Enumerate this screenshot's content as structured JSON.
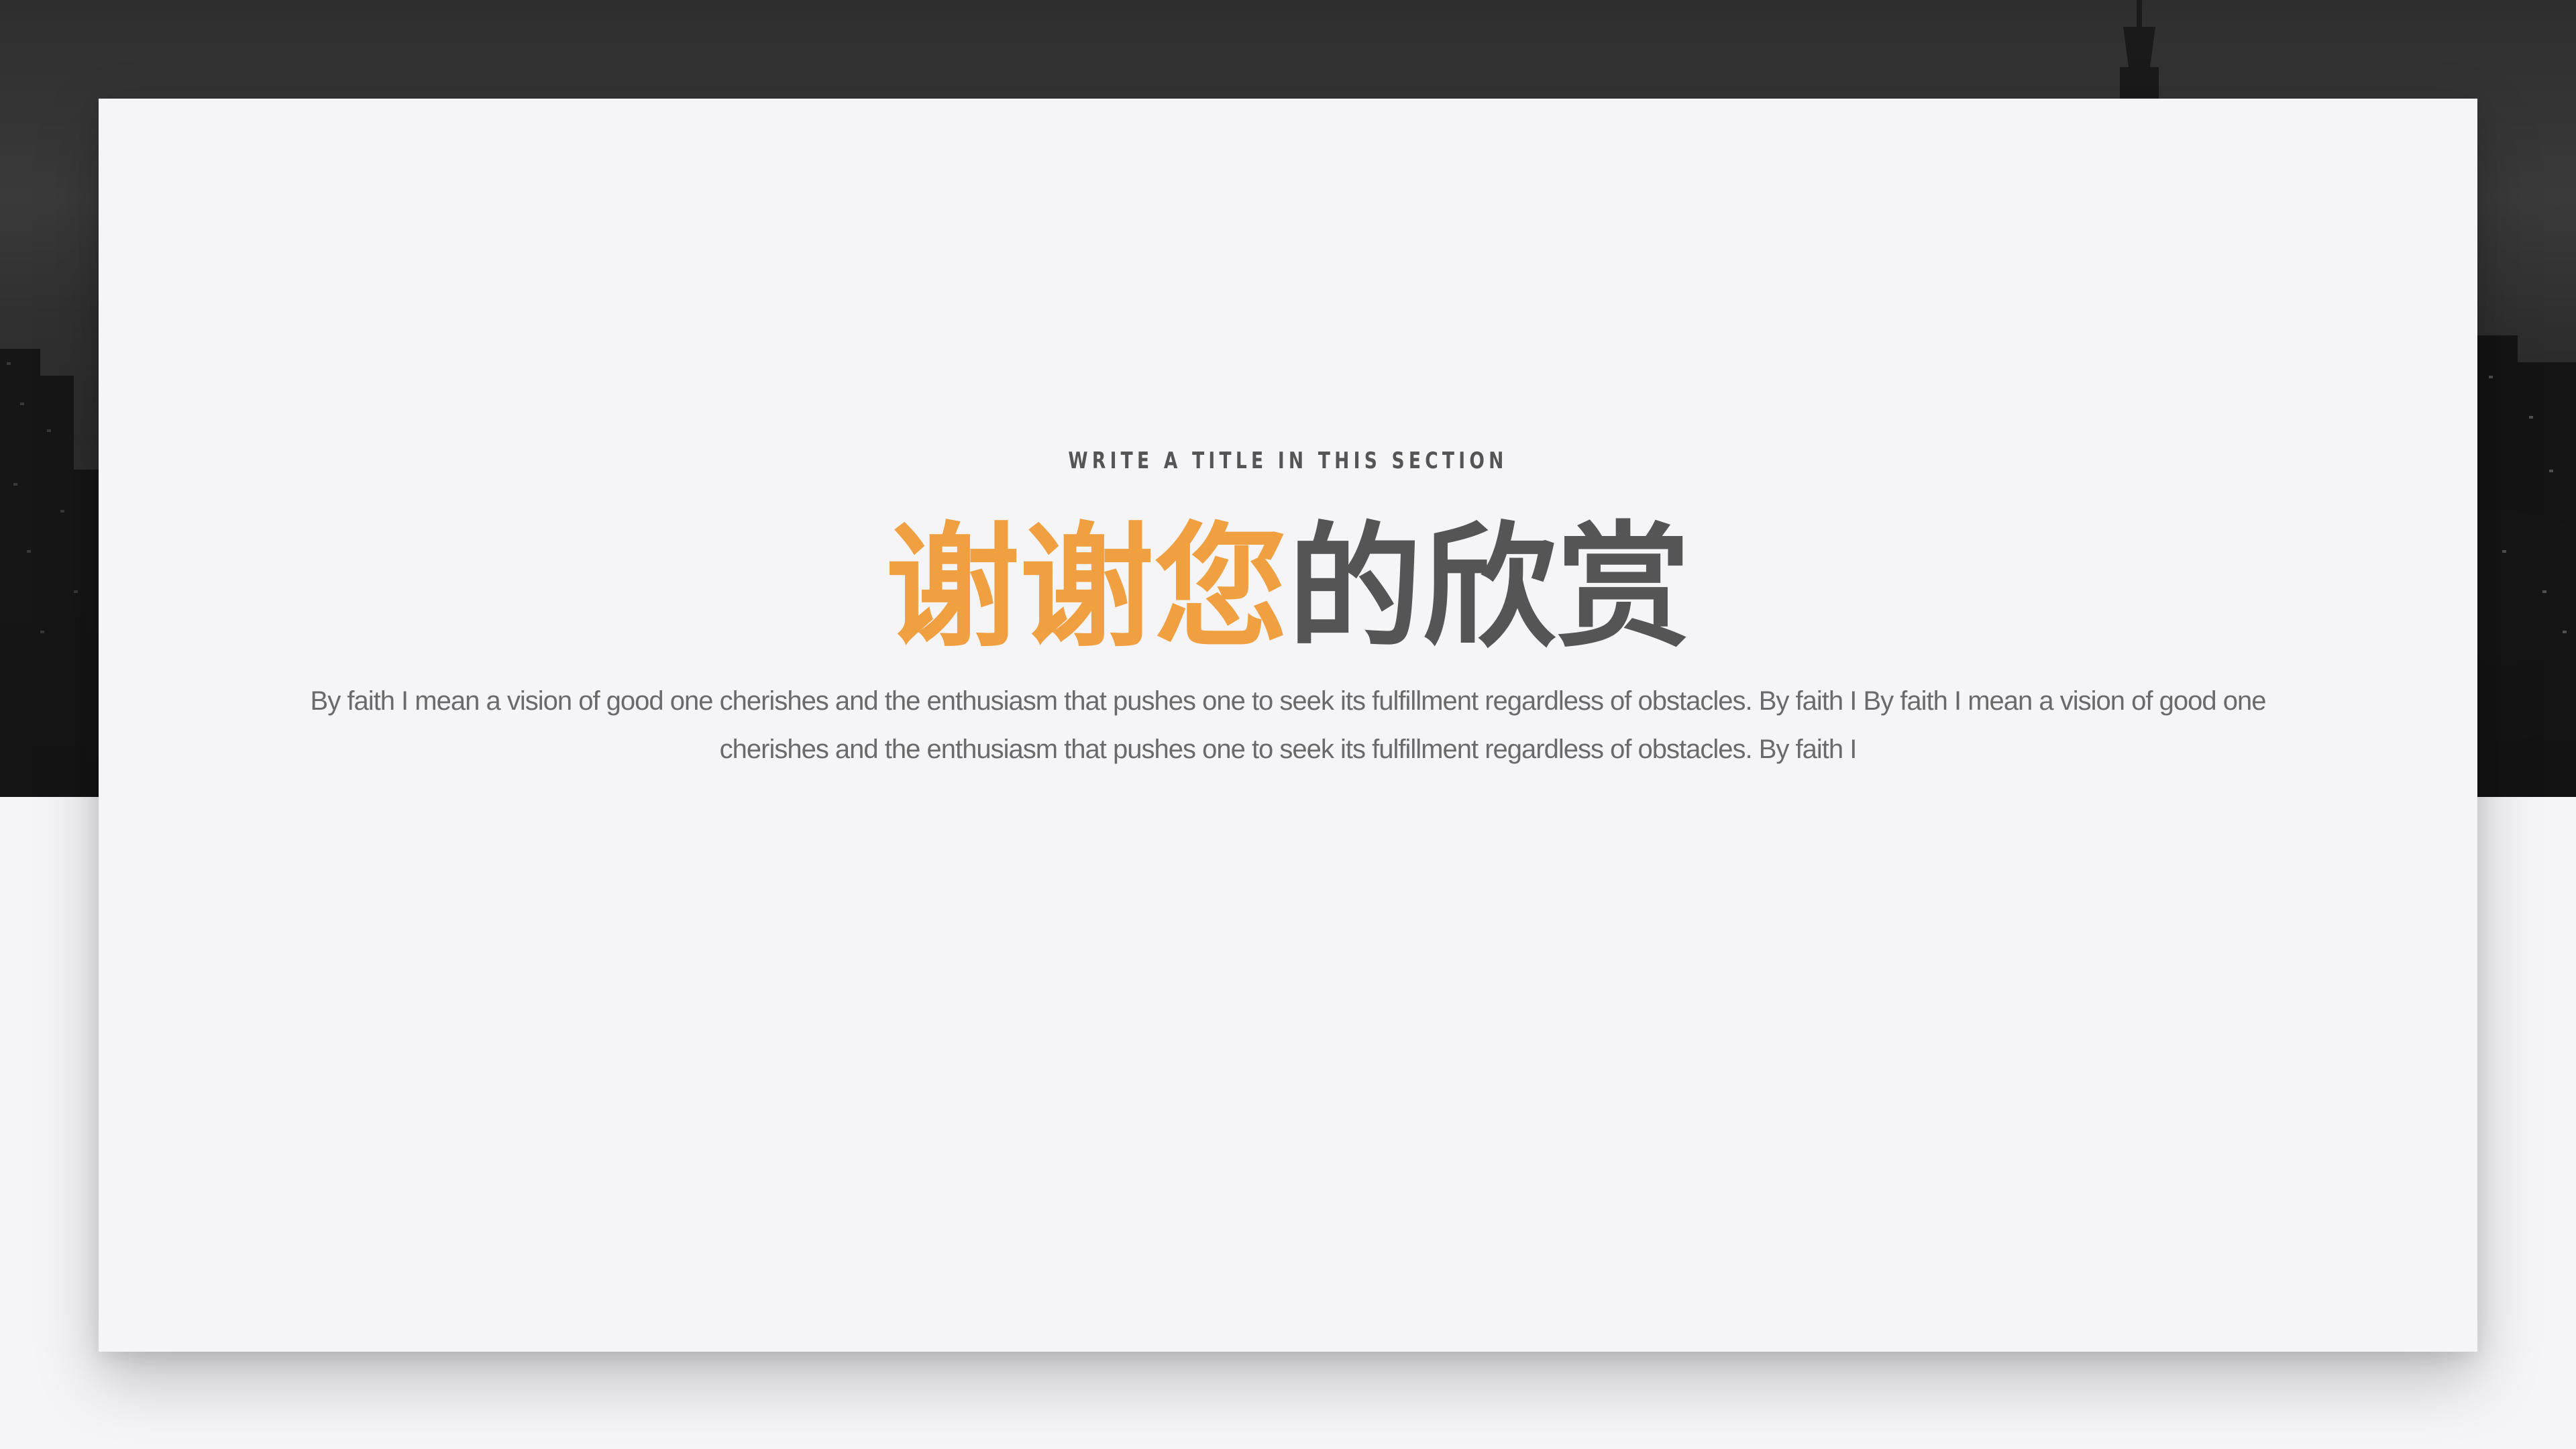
{
  "slide": {
    "eyebrow": "WRITE A TITLE IN THIS SECTION",
    "headline_accent": "谢谢您",
    "headline_rest": "的欣赏",
    "body": "By faith I mean a vision of good one cherishes and the enthusiasm that pushes one to seek its fulfillment regardless of obstacles. By faith I By faith I mean a vision of good one cherishes and the enthusiasm that pushes one to seek its fulfillment regardless of obstacles. By faith I"
  },
  "colors": {
    "accent": "#f0a040",
    "heading": "#555555",
    "body": "#6a6a6a",
    "background": "#f5f4f7",
    "photo_band": "#2a2a2a"
  }
}
